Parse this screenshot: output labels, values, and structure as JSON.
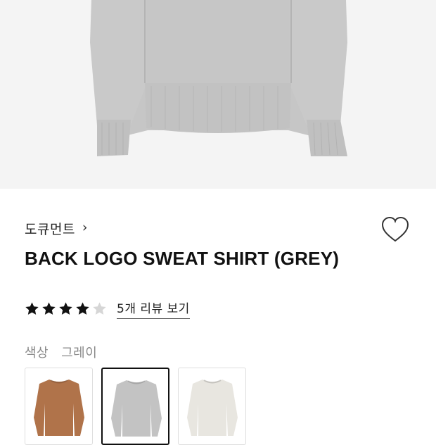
{
  "product": {
    "brand": "도큐먼트",
    "brand_chevron": "›",
    "title": "BACK LOGO SWEAT SHIRT (GREY)",
    "rating": 4,
    "rating_max": 5,
    "review_link": "5개 리뷰 보기",
    "wishlist_icon": "heart-outline-icon",
    "hero_image": "grey-sweatshirt-photo"
  },
  "color": {
    "label": "색상",
    "selected_value": "그레이",
    "options": [
      {
        "name": "brown",
        "color": "#b0734a",
        "selected": false
      },
      {
        "name": "grey",
        "color": "#c3c3c3",
        "selected": true
      },
      {
        "name": "ivory",
        "color": "#e8e6e0",
        "selected": false
      }
    ]
  },
  "colors": {
    "hero_bg": "#f4f4f4",
    "text": "#111111",
    "muted": "#8a8a8a",
    "star_empty": "#d6d6d6"
  }
}
